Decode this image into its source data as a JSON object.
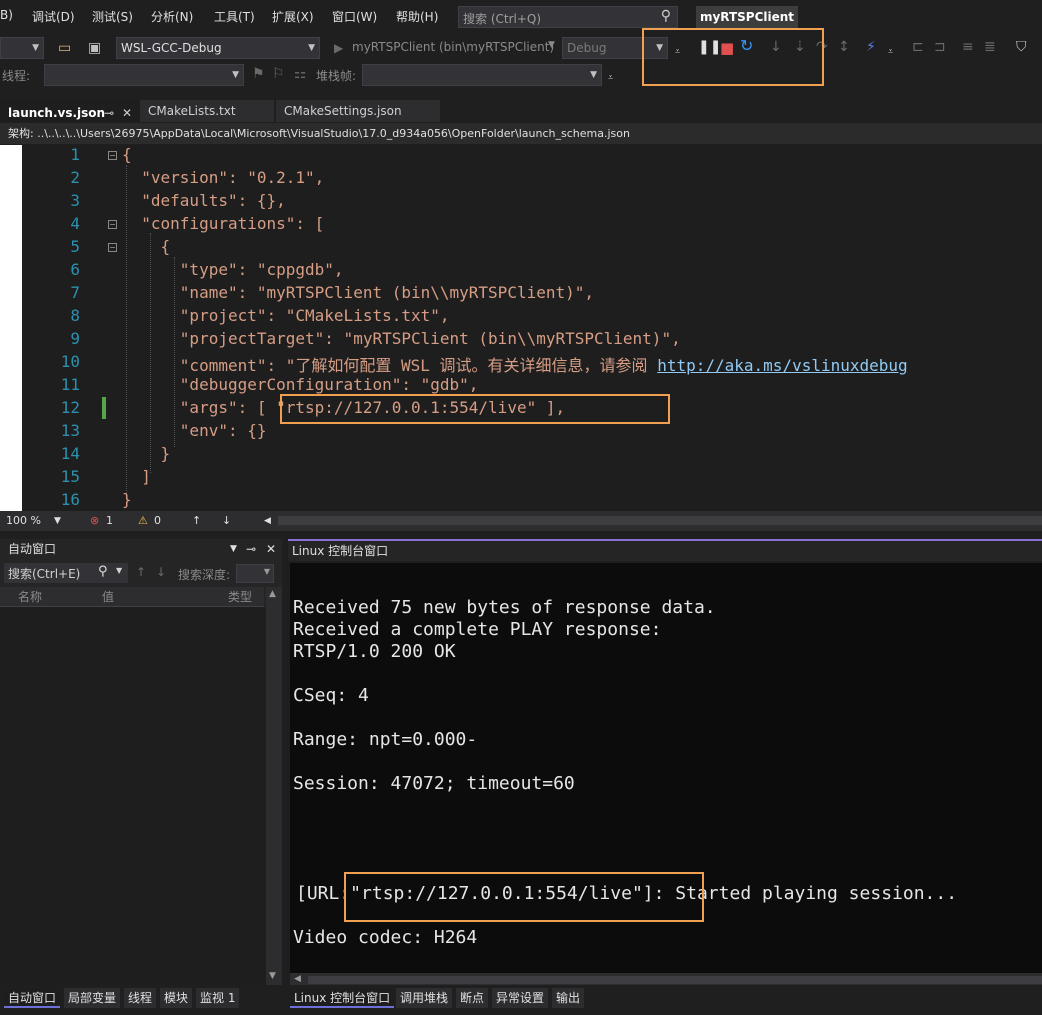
{
  "menu": {
    "items": [
      "B)",
      "调试(D)",
      "测试(S)",
      "分析(N)",
      "工具(T)",
      "扩展(X)",
      "窗口(W)",
      "帮助(H)"
    ],
    "search_placeholder": "搜索 (Ctrl+Q)",
    "app_title": "myRTSPClient"
  },
  "toolbar": {
    "config": "WSL-GCC-Debug",
    "startup_item": "myRTSPClient (bin\\myRTSPClient)",
    "build_config": "Debug",
    "thread_label": "线程:",
    "stackframe_label": "堆栈帧:"
  },
  "tabs": [
    {
      "label": "launch.vs.json",
      "active": true
    },
    {
      "label": "CMakeLists.txt",
      "active": false
    },
    {
      "label": "CMakeSettings.json",
      "active": false
    }
  ],
  "schema_bar": "架构: ..\\..\\..\\..\\Users\\26975\\AppData\\Local\\Microsoft\\VisualStudio\\17.0_d934a056\\OpenFolder\\launch_schema.json",
  "editor": {
    "line_numbers": [
      "1",
      "2",
      "3",
      "4",
      "5",
      "6",
      "7",
      "8",
      "9",
      "10",
      "11",
      "12",
      "13",
      "14",
      "15",
      "16"
    ],
    "lines": [
      "{",
      "  \"version\": \"0.2.1\",",
      "  \"defaults\": {},",
      "  \"configurations\": [",
      "    {",
      "      \"type\": \"cppgdb\",",
      "      \"name\": \"myRTSPClient (bin\\\\myRTSPClient)\",",
      "      \"project\": \"CMakeLists.txt\",",
      "      \"projectTarget\": \"myRTSPClient (bin\\\\myRTSPClient)\",",
      "      \"comment\": \"了解如何配置 WSL 调试。有关详细信息，请参阅 ",
      "      \"debuggerConfiguration\": \"gdb\",",
      "      \"args\": [ \"rtsp://127.0.0.1:554/live\" ],",
      "      \"env\": {}",
      "    }",
      "  ]",
      "}"
    ],
    "comment_link": "http://aka.ms/vslinuxdebug"
  },
  "status": {
    "zoom": "100 %",
    "errors": "1",
    "warnings": "0"
  },
  "autos": {
    "title": "自动窗口",
    "search_placeholder": "搜索(Ctrl+E)",
    "depth_label": "搜索深度:",
    "columns": [
      "名称",
      "值",
      "类型"
    ]
  },
  "console": {
    "title": "Linux 控制台窗口",
    "lines": [
      "Received 75 new bytes of response data.",
      "Received a complete PLAY response:",
      "RTSP/1.0 200 OK",
      "CSeq: 4",
      "Range: npt=0.000-",
      "Session: 47072; timeout=60",
      "[URL:\"rtsp://127.0.0.1:554/live\"]: Started playing session...",
      "Video codec: H264"
    ]
  },
  "bottom_tabs_left": [
    "自动窗口",
    "局部变量",
    "线程",
    "模块",
    "监视 1"
  ],
  "bottom_tabs_right": [
    "Linux 控制台窗口",
    "调用堆栈",
    "断点",
    "异常设置",
    "输出"
  ],
  "colors": {
    "highlight": "#f0a050",
    "string": "#d69d85",
    "line_number": "#2b91af",
    "stop": "#e05050",
    "restart": "#3794ff"
  }
}
